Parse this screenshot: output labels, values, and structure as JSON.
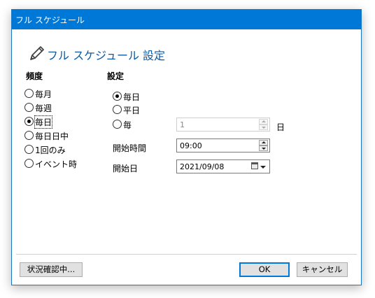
{
  "window": {
    "title": "フル スケジュール"
  },
  "heading": {
    "text": "フル スケジュール 設定",
    "icon": "pencil-icon"
  },
  "frequency": {
    "label": "頻度",
    "options": [
      "毎月",
      "毎週",
      "毎日",
      "毎日日中",
      "1回のみ",
      "イベント時"
    ],
    "selected": "毎日"
  },
  "settings": {
    "label": "設定",
    "options": [
      "毎日",
      "平日",
      "毎"
    ],
    "selected": "毎日",
    "every_n_value": "1",
    "every_n_unit": "日",
    "start_time_label": "開始時間",
    "start_time_value": "09:00",
    "start_date_label": "開始日",
    "start_date_value": "2021/09/08"
  },
  "footer": {
    "status_button": "状況確認中...",
    "ok_button": "OK",
    "cancel_button": "キャンセル"
  },
  "colors": {
    "titlebar": "#0078d7",
    "heading": "#0b5aa8"
  }
}
